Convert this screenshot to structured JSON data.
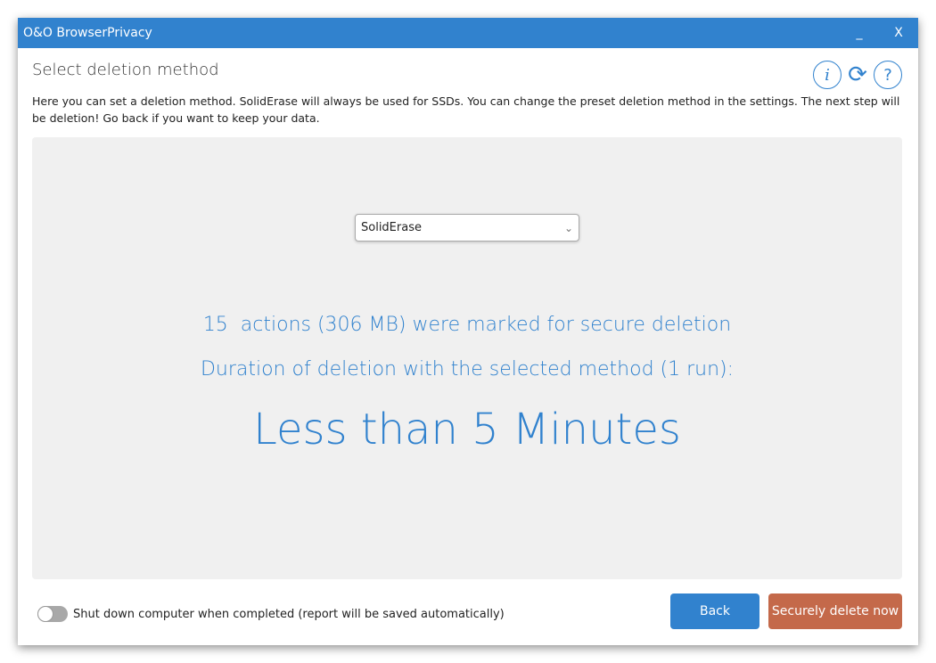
{
  "window": {
    "title": "O&O BrowserPrivacy",
    "minimize": "_",
    "close": "X"
  },
  "header": {
    "title": "Select deletion method",
    "description": "Here you can set a deletion method. SolidErase will always be used for SSDs. You can change the preset deletion method in the settings. The next step will be deletion! Go back if you want to keep your data.",
    "icons": {
      "info": "i",
      "refresh": "⟳",
      "help": "?"
    }
  },
  "method": {
    "selected": "SolidErase"
  },
  "summary": {
    "actions": "15  actions (306 MB) were marked for secure deletion",
    "duration_label": "Duration of deletion with the selected method (1 run):",
    "duration": "Less than 5 Minutes"
  },
  "footer": {
    "shutdown_label": "Shut down computer when completed (report will be saved automatically)",
    "shutdown_enabled": false,
    "back": "Back",
    "delete": "Securely delete now"
  },
  "colors": {
    "accent": "#3182ce",
    "danger": "#c4694a"
  }
}
